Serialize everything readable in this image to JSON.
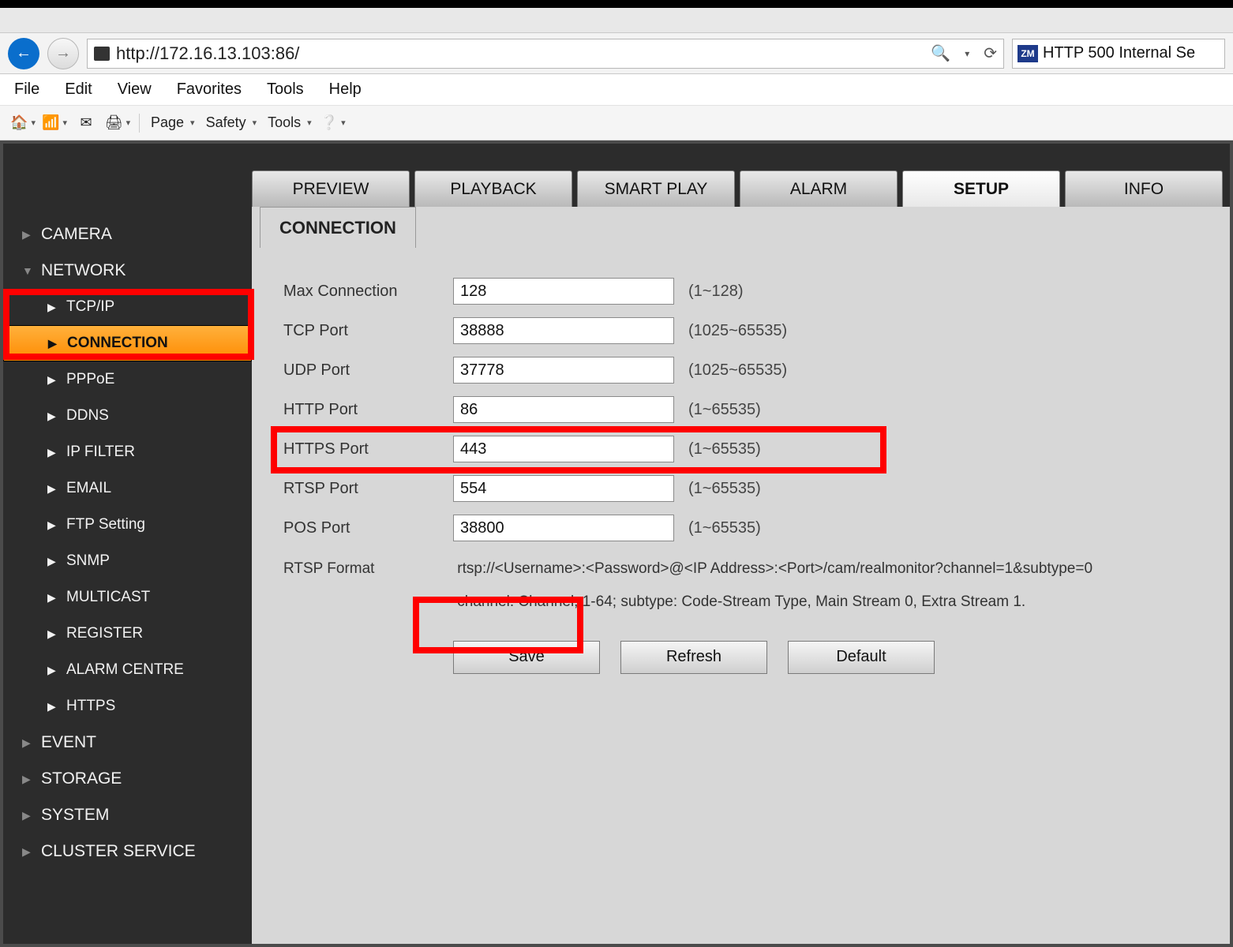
{
  "browser": {
    "url": "http://172.16.13.103:86/",
    "second_tab_title": "HTTP 500 Internal Se",
    "menus": [
      "File",
      "Edit",
      "View",
      "Favorites",
      "Tools",
      "Help"
    ],
    "toolbar_labels": {
      "page": "Page",
      "safety": "Safety",
      "tools": "Tools"
    }
  },
  "app": {
    "tabs": [
      "PREVIEW",
      "PLAYBACK",
      "SMART PLAY",
      "ALARM",
      "SETUP",
      "INFO"
    ],
    "active_tab": "SETUP",
    "sidebar": {
      "camera": "CAMERA",
      "network": "NETWORK",
      "network_children": [
        "TCP/IP",
        "CONNECTION",
        "PPPoE",
        "DDNS",
        "IP FILTER",
        "EMAIL",
        "FTP Setting",
        "SNMP",
        "MULTICAST",
        "REGISTER",
        "ALARM CENTRE",
        "HTTPS"
      ],
      "event": "EVENT",
      "storage": "STORAGE",
      "system": "SYSTEM",
      "cluster": "CLUSTER SERVICE"
    },
    "panel_title": "CONNECTION",
    "fields": {
      "max_connection": {
        "label": "Max Connection",
        "value": "128",
        "hint": "(1~128)"
      },
      "tcp_port": {
        "label": "TCP Port",
        "value": "38888",
        "hint": "(1025~65535)"
      },
      "udp_port": {
        "label": "UDP Port",
        "value": "37778",
        "hint": "(1025~65535)"
      },
      "http_port": {
        "label": "HTTP Port",
        "value": "86",
        "hint": "(1~65535)"
      },
      "https_port": {
        "label": "HTTPS Port",
        "value": "443",
        "hint": "(1~65535)"
      },
      "rtsp_port": {
        "label": "RTSP Port",
        "value": "554",
        "hint": "(1~65535)"
      },
      "pos_port": {
        "label": "POS Port",
        "value": "38800",
        "hint": "(1~65535)"
      }
    },
    "rtsp_format": {
      "label": "RTSP Format",
      "line1": "rtsp://<Username>:<Password>@<IP Address>:<Port>/cam/realmonitor?channel=1&subtype=0",
      "line2": "channel: Channel, 1-64; subtype: Code-Stream Type, Main Stream 0, Extra Stream 1."
    },
    "buttons": {
      "save": "Save",
      "refresh": "Refresh",
      "default": "Default"
    }
  }
}
